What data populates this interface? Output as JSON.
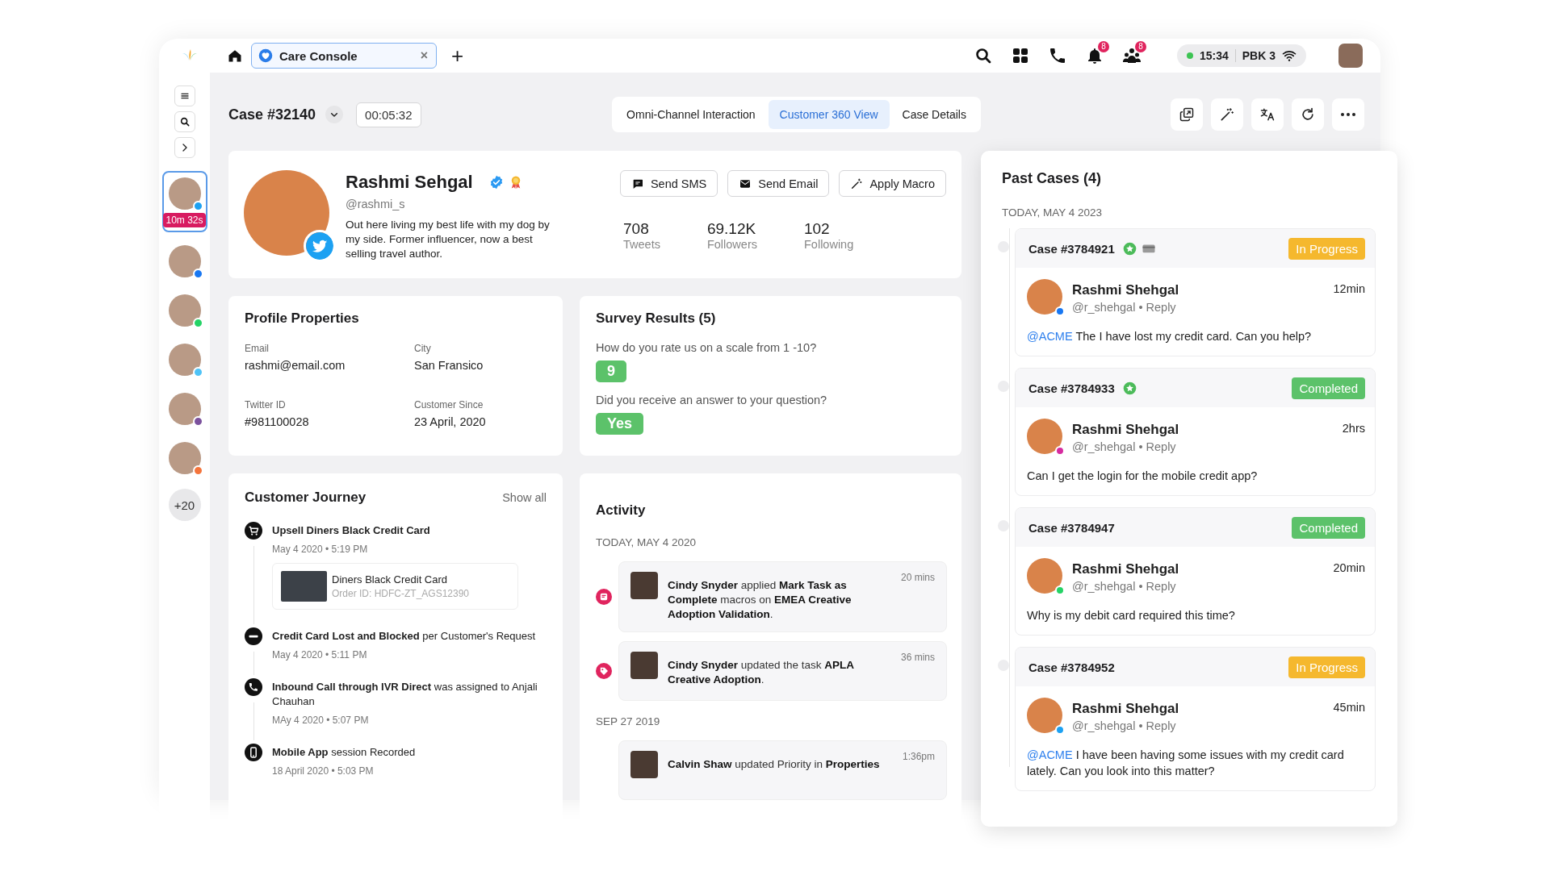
{
  "top_bar": {
    "tab": {
      "label": "Care Console",
      "close": "×",
      "selected": true
    },
    "new_tab": "+",
    "notifications": [
      {
        "kind": "bell",
        "count": "8"
      },
      {
        "kind": "people",
        "count": "8"
      }
    ],
    "status": {
      "online": true,
      "time": "15:34",
      "line": "PBK 3"
    }
  },
  "rail": {
    "contacts": [
      {
        "selected": true,
        "timer": "10m 32s",
        "color": "#1da1f2"
      },
      {
        "selected": false,
        "color": "#1877f2"
      },
      {
        "selected": false,
        "color": "#25d366"
      },
      {
        "selected": false,
        "color": "#4fc3f7"
      },
      {
        "selected": false,
        "color": "#7b519d"
      },
      {
        "selected": false,
        "color": "#f4743b"
      }
    ],
    "more": "+20"
  },
  "case": {
    "title": "Case #32140",
    "timer": "00:05:32",
    "tabs": [
      {
        "label": "Omni-Channel Interaction",
        "selected": false
      },
      {
        "label": "Customer 360 View",
        "selected": true
      },
      {
        "label": "Case Details",
        "selected": false
      }
    ]
  },
  "profile": {
    "name": "Rashmi Sehgal",
    "handle": "@rashmi_s",
    "bio": "Out here living my best life with my dog by my side. Former influencer, now a best selling travel author.",
    "actions": [
      {
        "kind": "sms",
        "label": "Send SMS"
      },
      {
        "kind": "email",
        "label": "Send Email"
      },
      {
        "kind": "macro",
        "label": "Apply Macro"
      }
    ],
    "stats": [
      {
        "value": "708",
        "label": "Tweets"
      },
      {
        "value": "69.12K",
        "label": "Followers"
      },
      {
        "value": "102",
        "label": "Following"
      }
    ]
  },
  "profile_properties": {
    "title": "Profile Properties",
    "fields": [
      {
        "label": "Email",
        "value": "rashmi@email.com"
      },
      {
        "label": "City",
        "value": "San Fransico"
      },
      {
        "label": "Twitter ID",
        "value": "#981100028"
      },
      {
        "label": "Customer Since",
        "value": "23 April, 2020"
      }
    ]
  },
  "survey": {
    "title": "Survey Results (5)",
    "questions": [
      {
        "question": "How do you rate us on a scale from 1 -10?",
        "answer": "9"
      },
      {
        "question": "Did you receive an answer to your question?",
        "answer": "Yes"
      }
    ]
  },
  "customer_journey": {
    "title": "Customer Journey",
    "show_all": "Show all",
    "events": [
      {
        "kind": "cart",
        "text": "Upsell Diners Black Credit Card",
        "bold": true,
        "time": "May 4 2020 • 5:19 PM",
        "attachment": {
          "title": "Diners Black Credit Card",
          "subtitle": "Order ID: HDFC-ZT_AGS12390"
        }
      },
      {
        "kind": "blocked",
        "text": "**Credit Card Lost and Blocked** per Customer's Request",
        "bold": false,
        "time": "May 4 2020 • 5:11 PM"
      },
      {
        "kind": "call",
        "text": "**Inbound Call through IVR Direct** was assigned to Anjali Chauhan",
        "bold": false,
        "time": "MAy 4 2020 • 5:07 PM"
      },
      {
        "kind": "mobile",
        "text": "**Mobile App** session Recorded",
        "bold": false,
        "time": "18 April 2020 • 5:03 PM"
      }
    ]
  },
  "activity": {
    "title": "Activity",
    "groups": [
      {
        "date": "TODAY, MAY 4 2020",
        "items": [
          {
            "kind": "note",
            "text": "**Cindy Snyder** applied **Mark Task as Complete** macros on **EMEA Creative Adoption Validation**.",
            "time": "20 mins"
          },
          {
            "kind": "tag",
            "text": "**Cindy Snyder** updated the task **APLA Creative Adoption**.",
            "time": "36 mins"
          }
        ]
      },
      {
        "date": "SEP 27 2019",
        "items": [
          {
            "kind": "none",
            "text": "**Calvin Shaw** updated Priority in **Properties**",
            "time": "1:36pm"
          }
        ]
      }
    ]
  },
  "past_cases": {
    "title": "Past Cases (4)",
    "date": "TODAY, MAY 4 2023",
    "cases": [
      {
        "number": "Case #3784921",
        "starred": true,
        "has_card": true,
        "status": "In Progress",
        "kind": "in_progress",
        "author": "Rashmi Shehgal",
        "handle": "@r_shehgal • Reply",
        "time": "12min",
        "color": "#1877f2",
        "mention": "@ACME",
        "message": "The I have lost my credit card. Can you help?"
      },
      {
        "number": "Case #3784933",
        "starred": true,
        "has_card": false,
        "status": "Completed",
        "kind": "completed",
        "author": "Rashmi Shehgal",
        "handle": "@r_shehgal • Reply",
        "time": "2hrs",
        "color": "#d62ba0",
        "message": "Can I get the login for the mobile credit app?"
      },
      {
        "number": "Case #3784947",
        "starred": false,
        "has_card": false,
        "status": "Completed",
        "kind": "completed",
        "author": "Rashmi Shehgal",
        "handle": "@r_shehgal • Reply",
        "time": "20min",
        "color": "#25d366",
        "message": "Why is my debit card required this time?"
      },
      {
        "number": "Case #3784952",
        "starred": false,
        "has_card": false,
        "status": "In Progress",
        "kind": "in_progress",
        "author": "Rashmi Shehgal",
        "handle": "@r_shehgal • Reply",
        "time": "45min",
        "color": "#1da1f2",
        "mention": "@ACME",
        "message": "I have been having some issues with my credit card lately. Can you look into this matter?"
      }
    ]
  }
}
